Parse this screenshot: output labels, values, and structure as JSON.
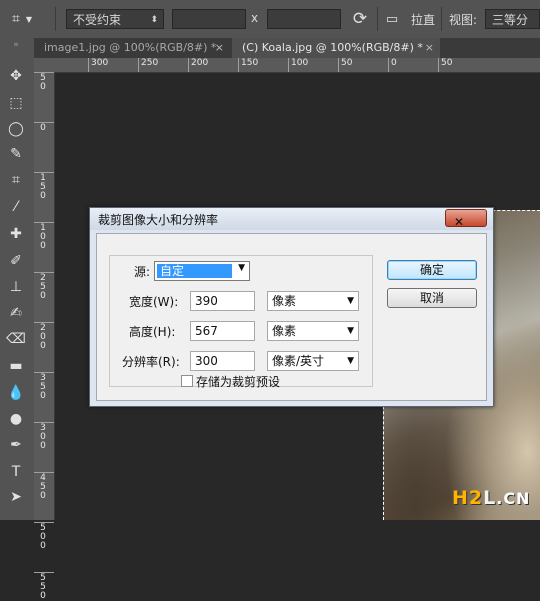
{
  "options_bar": {
    "ratio_select": "不受约束",
    "x_separator": "x",
    "straighten_label": "拉直",
    "view_label": "视图:",
    "view_select": "三等分"
  },
  "tabs": [
    {
      "label": "image1.jpg @ 100%(RGB/8#) *",
      "close": "×"
    },
    {
      "label": "(C) Koala.jpg @ 100%(RGB/8#) *",
      "close": "×"
    }
  ],
  "ruler": {
    "h_labels": [
      "300",
      "250",
      "200",
      "150",
      "100",
      "50",
      "0",
      "50"
    ],
    "v_labels": [
      [
        "5",
        "0"
      ],
      [
        "0"
      ],
      [
        "1",
        "5",
        "0"
      ],
      [
        "1",
        "0",
        "0"
      ],
      [
        "2",
        "5",
        "0"
      ],
      [
        "2",
        "0",
        "0"
      ],
      [
        "3",
        "5",
        "0"
      ],
      [
        "3",
        "0",
        "0"
      ],
      [
        "4",
        "5",
        "0"
      ],
      [
        "5",
        "0",
        "0"
      ],
      [
        "5",
        "5",
        "0"
      ]
    ]
  },
  "dialog": {
    "title": "裁剪图像大小和分辨率",
    "close_label": "✕",
    "source_label": "源:",
    "source_value": "自定",
    "width_label": "宽度(W):",
    "width_value": "390",
    "width_unit": "像素",
    "height_label": "高度(H):",
    "height_value": "567",
    "height_unit": "像素",
    "resolution_label": "分辨率(R):",
    "resolution_value": "300",
    "resolution_unit": "像素/英寸",
    "save_preset_label": "存储为裁剪预设",
    "ok_label": "确定",
    "cancel_label": "取消"
  },
  "watermark": {
    "h2": "H2",
    "l": "L",
    "cn": ".CN"
  }
}
